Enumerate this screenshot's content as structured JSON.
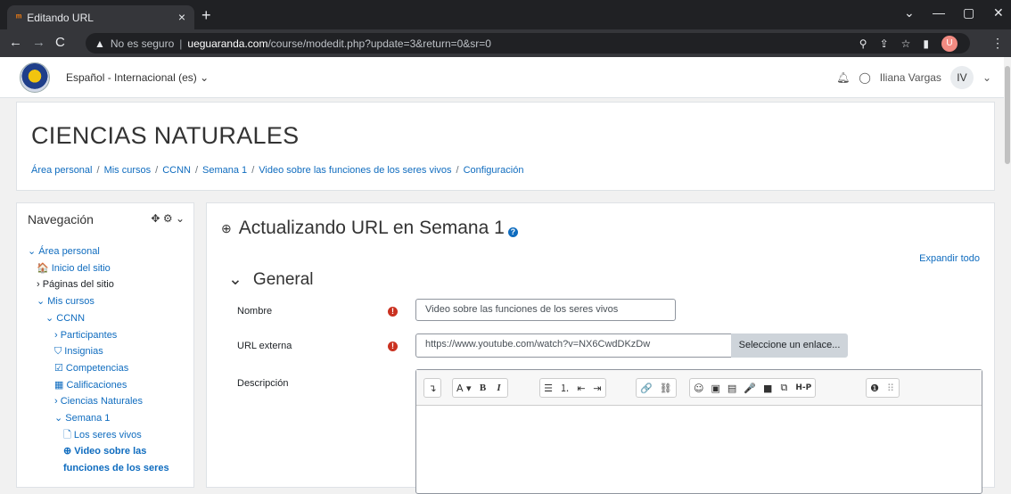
{
  "browser": {
    "tab_title": "Editando URL",
    "tab_favicon": "moodle-icon",
    "close_tab": "×",
    "new_tab": "+",
    "window_controls": [
      "⌄",
      "—",
      "▢",
      "✕"
    ],
    "security_label": "No es seguro",
    "url_domain": "ueguaranda.com",
    "url_path": "/course/modedit.php?update=3&return=0&sr=0",
    "profile_initial": "U"
  },
  "topnav": {
    "language": "Español - Internacional (es) ⌄",
    "user_name": "Iliana Vargas",
    "user_initials": "IV",
    "caret": "⌄"
  },
  "header": {
    "course_title": "CIENCIAS NATURALES",
    "breadcrumb": [
      "Área personal",
      "Mis cursos",
      "CCNN",
      "Semana 1",
      "Video sobre las funciones de los seres vivos",
      "Configuración"
    ],
    "breadcrumb_sep": "/"
  },
  "navigation": {
    "title": "Navegación",
    "items": [
      {
        "label": "⌄ Área personal"
      },
      {
        "label": "🏠 Inicio del sitio"
      },
      {
        "label": "› Páginas del sitio"
      },
      {
        "label": "⌄ Mis cursos"
      },
      {
        "label": "⌄ CCNN"
      },
      {
        "label": "› Participantes"
      },
      {
        "label": "⛉ Insignias"
      },
      {
        "label": "☑ Competencias"
      },
      {
        "label": "▦ Calificaciones"
      },
      {
        "label": "› Ciencias Naturales"
      },
      {
        "label": "⌄ Semana 1"
      },
      {
        "label": "🗋 Los seres vivos"
      },
      {
        "label": "⊕ Video sobre las"
      },
      {
        "label": "funciones de los seres"
      }
    ]
  },
  "main": {
    "heading": "Actualizando URL en Semana 1",
    "heading_help": "?",
    "expand_all": "Expandir todo",
    "section_label": "General",
    "section_chevron": "⌄",
    "required_marker": "!",
    "fields": {
      "name_label": "Nombre",
      "name_value": "Video sobre las funciones de los seres vivos",
      "url_label": "URL externa",
      "url_value": "https://www.youtube.com/watch?v=NX6CwdDKzDw",
      "select_link_label": "Seleccione un enlace...",
      "description_label": "Descripción"
    },
    "editor_toolbar": [
      [
        "↴"
      ],
      [
        "A ▾",
        "B",
        "I"
      ],
      [
        "☰",
        "⒈",
        "⇤",
        "⇥"
      ],
      [
        "🔗",
        "⛓"
      ],
      [
        "☺",
        "▣",
        "▤",
        "🎤",
        "■",
        "⧉",
        "H-P"
      ],
      [
        "❶",
        "⠿"
      ]
    ]
  }
}
